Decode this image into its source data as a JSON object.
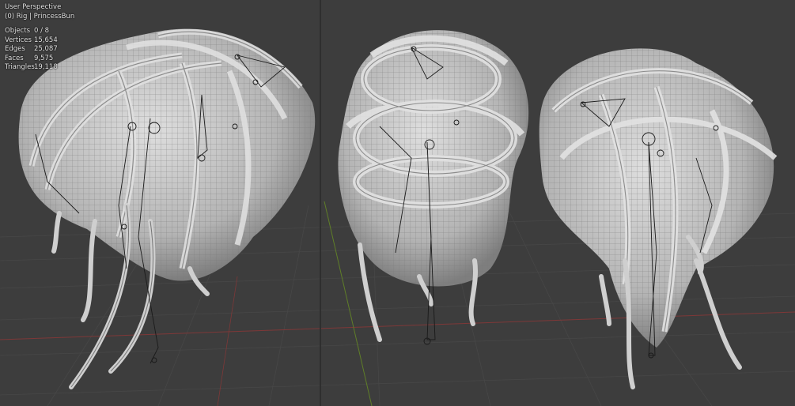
{
  "viewport": {
    "view_name": "User Perspective",
    "collection_info": "(0) Rig | PrincessBun"
  },
  "stats": [
    {
      "label": "Objects",
      "value": "0 / 8"
    },
    {
      "label": "Vertices",
      "value": "15,654"
    },
    {
      "label": "Edges",
      "value": "25,087"
    },
    {
      "label": "Faces",
      "value": "9,575"
    },
    {
      "label": "Triangles",
      "value": "19,118"
    }
  ],
  "colors": {
    "background": "#3d3d3d",
    "mesh": "#c4c4c4",
    "mesh_shadow": "#8a8a8a",
    "wire": "#6f6f6f",
    "grid": "#4a4a4a",
    "axis_x": "#8b3a3a",
    "axis_y": "#6a8a2a",
    "bones": "#1a1a1a"
  }
}
